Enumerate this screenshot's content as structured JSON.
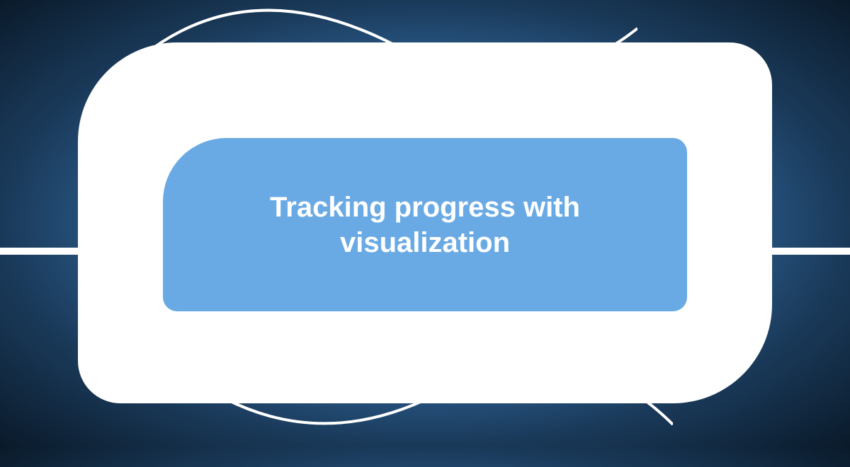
{
  "title": "Tracking progress with visualization",
  "colors": {
    "white": "#ffffff",
    "innerBlue": "#6aaae4",
    "bgDark": "#0a1a2a",
    "bgMid": "#3a7ab8"
  }
}
